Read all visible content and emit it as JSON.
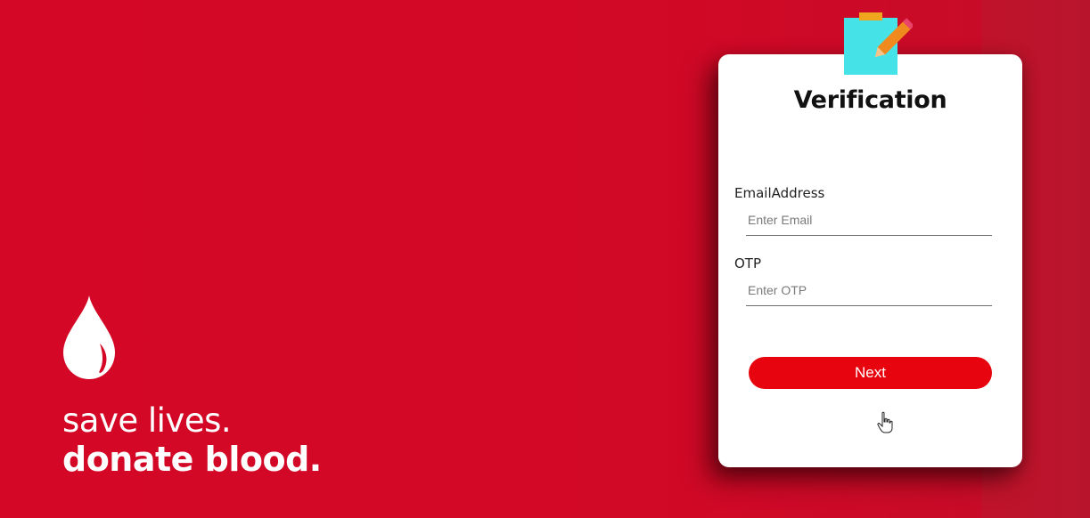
{
  "slogan": {
    "line1": "save lives.",
    "line2": "donate blood."
  },
  "card": {
    "title": "Verification",
    "email_label": "EmailAddress",
    "email_placeholder": "Enter Email",
    "email_value": "",
    "otp_label": "OTP",
    "otp_placeholder": "Enter OTP",
    "otp_value": "",
    "next_label": "Next"
  },
  "icons": {
    "logo": "blood-drop-icon",
    "header": "sticky-note-pencil-icon",
    "pointer": "hand-pointer-cursor-icon"
  },
  "colors": {
    "background": "#d40826",
    "accent_button": "#e8040e",
    "note": "#45e3e8",
    "pencil": "#f08a1e"
  }
}
